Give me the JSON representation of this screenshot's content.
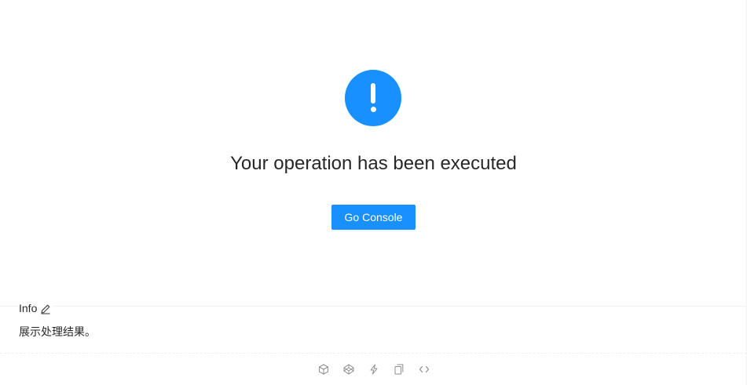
{
  "result": {
    "status": "info",
    "icon": "exclamation-icon",
    "title": "Your operation has been executed",
    "button_label": "Go Console",
    "accent_color": "#1890ff"
  },
  "meta": {
    "title": "Info",
    "edit_icon": "edit-icon",
    "description": "展示处理结果。"
  },
  "actions": [
    {
      "icon": "codesandbox-icon"
    },
    {
      "icon": "codepen-icon"
    },
    {
      "icon": "thunderbolt-icon"
    },
    {
      "icon": "copy-icon"
    },
    {
      "icon": "code-expand-icon"
    }
  ]
}
